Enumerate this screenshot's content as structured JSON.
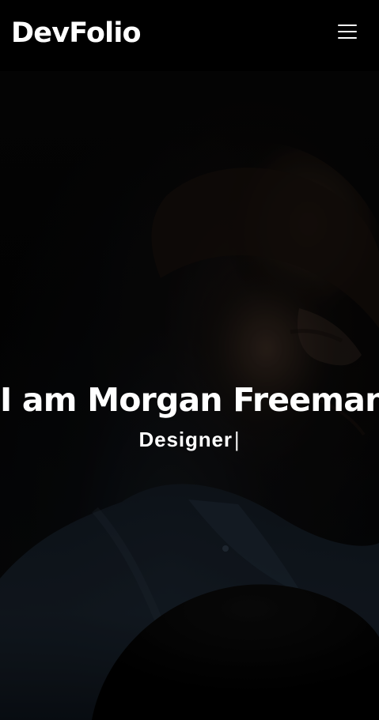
{
  "brand": {
    "text": "DevFolio"
  },
  "navbar": {
    "menu_icon": "hamburger-menu-icon"
  },
  "hero": {
    "title": "I am Morgan Freeman",
    "typed_text": "Designer",
    "cursor": "|",
    "background": "dark portrait of a man in profile wearing a denim shirt and holding a dark hat"
  },
  "colors": {
    "nav_background": "#000000",
    "text": "#ffffff",
    "hero_background": "#050505",
    "shirt": "#243241",
    "skin": "#3a2b22"
  }
}
